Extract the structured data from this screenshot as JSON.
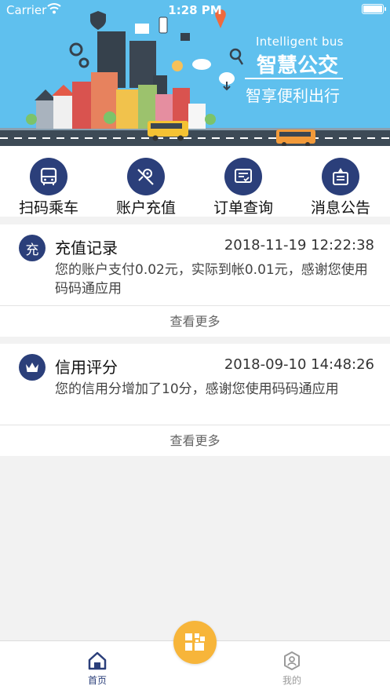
{
  "status_bar": {
    "carrier": "Carrier",
    "time": "1:28 PM"
  },
  "banner": {
    "title_en": "Intelligent bus",
    "title_cn": "智慧公交",
    "slogan": "智享便利出行"
  },
  "actions": [
    {
      "label": "扫码乘车",
      "icon": "bus-icon"
    },
    {
      "label": "账户充值",
      "icon": "wallet-icon"
    },
    {
      "label": "订单查询",
      "icon": "order-icon"
    },
    {
      "label": "消息公告",
      "icon": "notice-icon"
    }
  ],
  "cards": [
    {
      "badge": "充",
      "title": "充值记录",
      "date": "2018-11-19 12:22:38",
      "body": "您的账户支付0.02元，实际到帐0.01元，感谢您使用码码通应用",
      "more": "查看更多"
    },
    {
      "badge_icon": "crown-icon",
      "title": "信用评分",
      "date": "2018-09-10 14:48:26",
      "body": "您的信用分增加了10分，感谢您使用码码通应用",
      "more": "查看更多"
    }
  ],
  "tabbar": {
    "home_label": "首页",
    "mine_label": "我的",
    "active_color": "#2b3f7a",
    "inactive_color": "#9a9a9a"
  },
  "colors": {
    "accent": "#2b3f7a",
    "banner": "#5fc0ee",
    "scan": "#f7b53a"
  }
}
